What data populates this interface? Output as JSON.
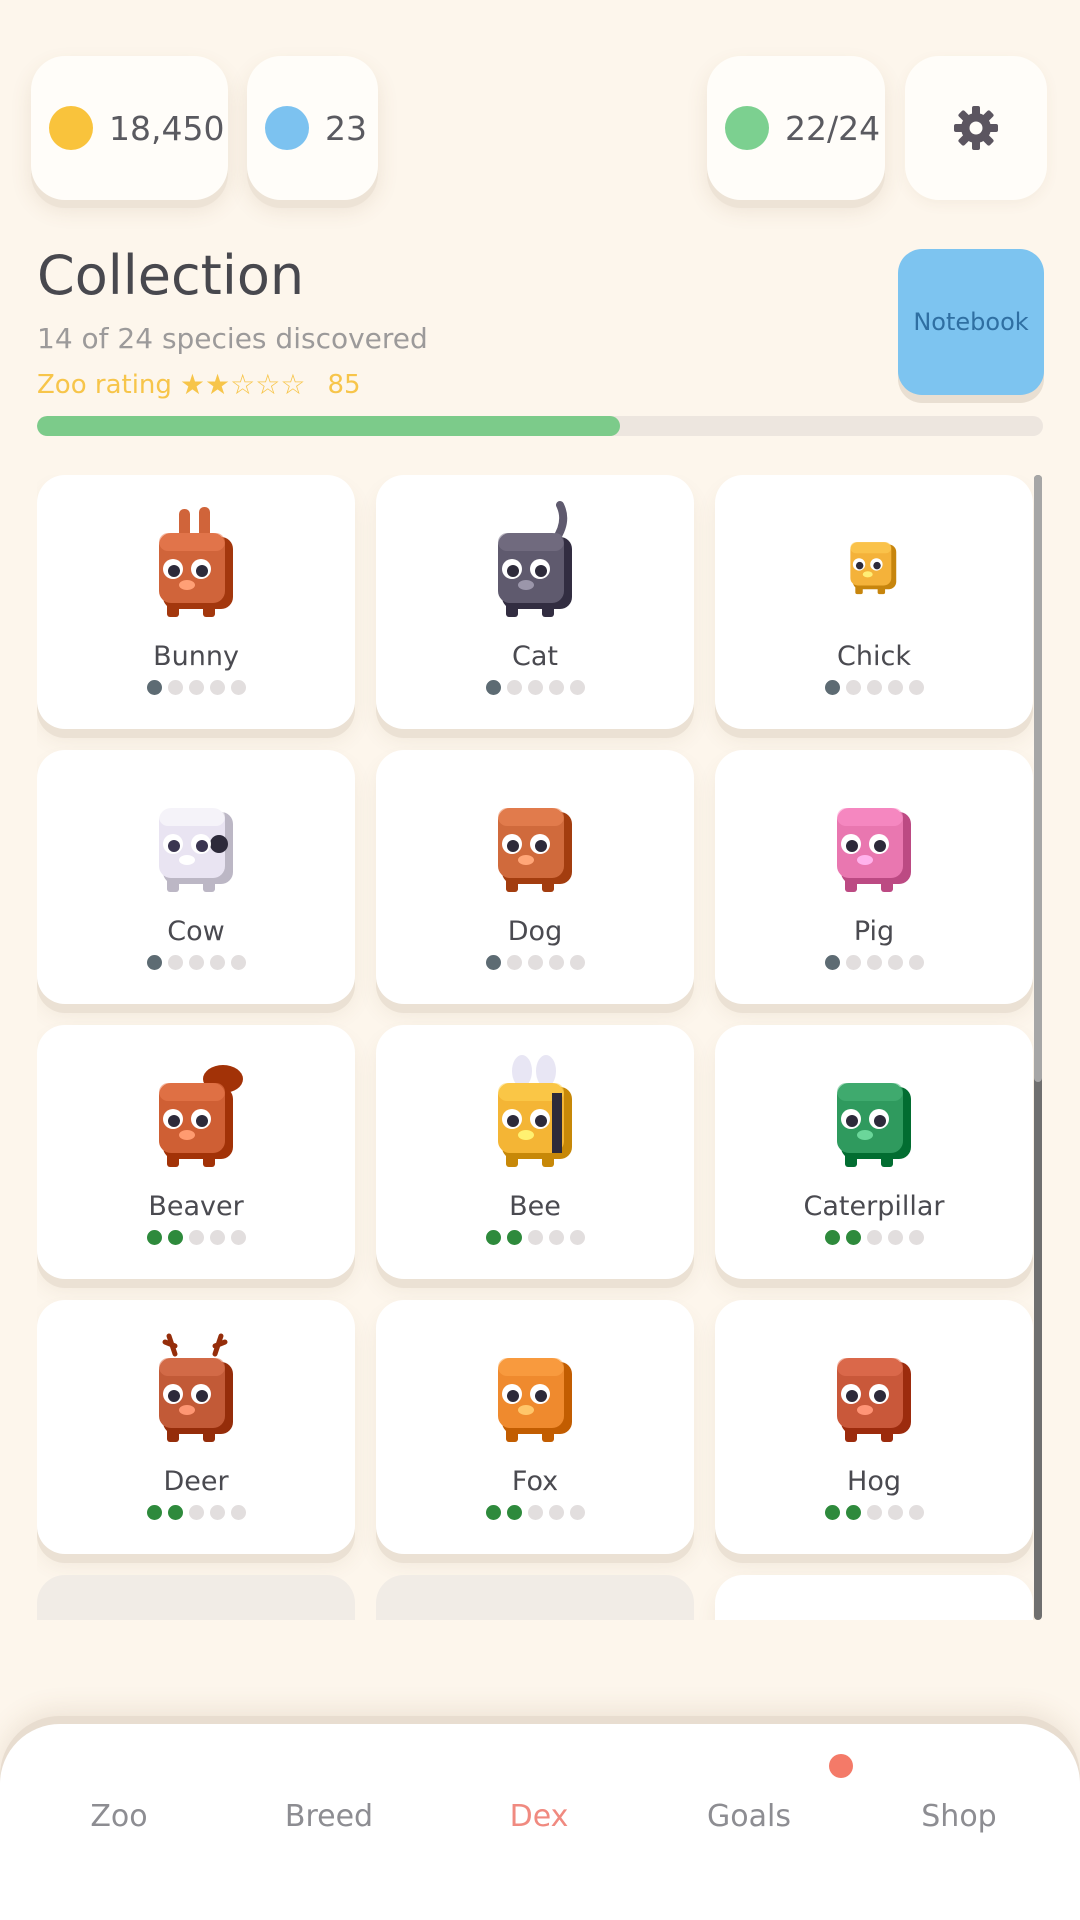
{
  "resources": {
    "coins": {
      "value": "18,450",
      "color": "#f9c33c",
      "icon": "coin-icon"
    },
    "gems": {
      "value": "23",
      "color": "#7cc2f0",
      "icon": "gem-icon"
    },
    "population": {
      "value": "22/24",
      "color": "#7cd090",
      "icon": "population-icon"
    }
  },
  "header": {
    "title": "Collection",
    "subtitle": "14 of 24 species discovered",
    "rating_label": "Zoo rating",
    "stars": "★★☆☆☆",
    "rating_value": "85",
    "notebook_label": "Notebook",
    "progress": 0.58
  },
  "animals": [
    {
      "name": "Bunny",
      "level": 1,
      "color": "#d0643a",
      "icon": "bunny-icon"
    },
    {
      "name": "Cat",
      "level": 1,
      "color": "#5f5a6e",
      "icon": "cat-icon"
    },
    {
      "name": "Chick",
      "level": 1,
      "color": "#f4b23a",
      "icon": "chick-icon"
    },
    {
      "name": "Cow",
      "level": 1,
      "color": "#e9e4f2",
      "icon": "cow-icon"
    },
    {
      "name": "Dog",
      "level": 1,
      "color": "#d06a3c",
      "icon": "dog-icon"
    },
    {
      "name": "Pig",
      "level": 1,
      "color": "#e977b0",
      "icon": "pig-icon"
    },
    {
      "name": "Beaver",
      "level": 2,
      "color": "#cf5f34",
      "icon": "beaver-icon"
    },
    {
      "name": "Bee",
      "level": 2,
      "color": "#f4b535",
      "icon": "bee-icon"
    },
    {
      "name": "Caterpillar",
      "level": 2,
      "color": "#2f9a5e",
      "icon": "caterpillar-icon"
    },
    {
      "name": "Deer",
      "level": 2,
      "color": "#c25a37",
      "icon": "deer-icon"
    },
    {
      "name": "Fox",
      "level": 2,
      "color": "#ef8a2e",
      "icon": "fox-icon"
    },
    {
      "name": "Hog",
      "level": 2,
      "color": "#c9583a",
      "icon": "hog-icon"
    }
  ],
  "nav": {
    "tabs": [
      "Zoo",
      "Breed",
      "Dex",
      "Goals",
      "Shop"
    ],
    "active": "Dex",
    "badge_tab": "Goals"
  }
}
